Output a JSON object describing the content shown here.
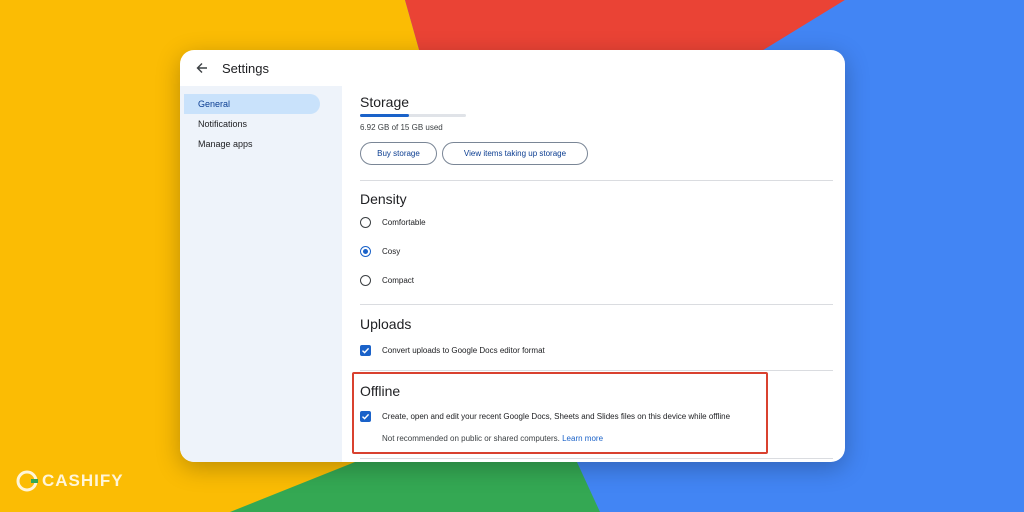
{
  "window": {
    "title": "Settings"
  },
  "sidebar": {
    "items": [
      {
        "label": "General",
        "active": true
      },
      {
        "label": "Notifications",
        "active": false
      },
      {
        "label": "Manage apps",
        "active": false
      }
    ]
  },
  "storage": {
    "title": "Storage",
    "used_text": "6.92 GB of 15 GB used",
    "used_fraction": 0.46,
    "buy_button": "Buy storage",
    "view_button": "View items taking up storage"
  },
  "density": {
    "title": "Density",
    "options": [
      {
        "label": "Comfortable",
        "selected": false
      },
      {
        "label": "Cosy",
        "selected": true
      },
      {
        "label": "Compact",
        "selected": false
      }
    ]
  },
  "uploads": {
    "title": "Uploads",
    "convert_label": "Convert uploads to Google Docs editor format",
    "convert_checked": true
  },
  "offline": {
    "title": "Offline",
    "enable_label": "Create, open and edit your recent Google Docs, Sheets and Slides files on this device while offline",
    "enable_checked": true,
    "note": "Not recommended on public or shared computers.",
    "learn_more": "Learn more"
  },
  "watermark": {
    "text": "CASHIFY"
  },
  "colors": {
    "accent": "#1a62c9",
    "highlight_border": "#d9412f",
    "sidebar_bg": "#eef3fa",
    "bg_yellow": "#fbbc04",
    "bg_red": "#ea4335",
    "bg_green": "#34a853",
    "bg_blue": "#4285f4"
  }
}
